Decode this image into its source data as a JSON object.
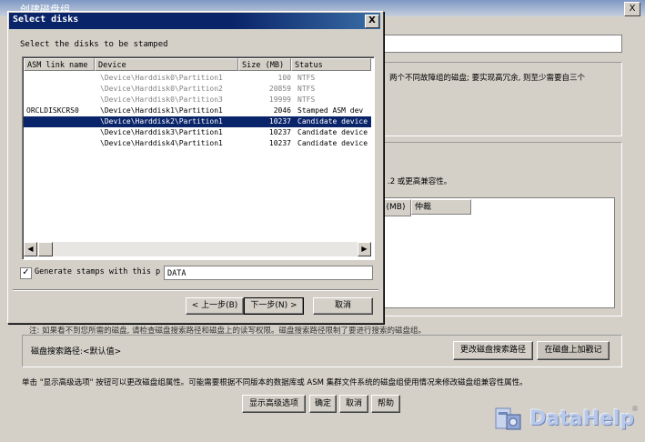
{
  "background_window": {
    "title": "创建磁盘组",
    "close_glyph": "X",
    "redundancy_text": "两个不同故障组的磁盘; 要实现高冗余, 则至少需要自三个",
    "failure_text": ".2 或更高兼容性。",
    "table_headers": [
      "(MB)",
      "仲裁"
    ],
    "note": "注: 如果看不到您所需的磁盘, 请检查磁盘搜索路径和磁盘上的读写权限。磁盘搜索路径限制了要进行搜索的磁盘组。",
    "disk_search_label": "磁盘搜索路径:<默认值>",
    "change_search_button": "更改磁盘搜索路径",
    "stamp_disks_button": "在磁盘上加戳记",
    "info": "单击 \"显示高级选项\" 按钮可以更改磁盘组属性。可能需要根据不同版本的数据库或 ASM 集群文件系统的磁盘组使用情况来修改磁盘组兼容性属性。",
    "advanced_button": "显示高级选项",
    "ok_button": "确定",
    "cancel_button": "取消",
    "help_button": "帮助"
  },
  "dialog": {
    "title": "Select disks",
    "close_glyph": "X",
    "instruction": "Select the disks to be stamped",
    "columns": [
      "ASM link name",
      "Device",
      "Size (MB)",
      "Status"
    ],
    "rows": [
      {
        "asm": "",
        "device": "\\Device\\Harddisk0\\Partition1",
        "size": "100",
        "status": "NTFS",
        "state": "disabled"
      },
      {
        "asm": "",
        "device": "\\Device\\Harddisk0\\Partition2",
        "size": "20859",
        "status": "NTFS",
        "state": "disabled"
      },
      {
        "asm": "",
        "device": "\\Device\\Harddisk0\\Partition3",
        "size": "19999",
        "status": "NTFS",
        "state": "disabled"
      },
      {
        "asm": "ORCLDISKCRS0",
        "device": "\\Device\\Harddisk1\\Partition1",
        "size": "2046",
        "status": "Stamped ASM dev",
        "state": "normal"
      },
      {
        "asm": "",
        "device": "\\Device\\Harddisk2\\Partition1",
        "size": "10237",
        "status": "Candidate device",
        "state": "selected"
      },
      {
        "asm": "",
        "device": "\\Device\\Harddisk3\\Partition1",
        "size": "10237",
        "status": "Candidate device",
        "state": "normal"
      },
      {
        "asm": "",
        "device": "\\Device\\Harddisk4\\Partition1",
        "size": "10237",
        "status": "Candidate device",
        "state": "normal"
      }
    ],
    "generate_checkbox_label": "Generate stamps with this p",
    "generate_checked": true,
    "stamp_prefix_value": "DATA",
    "back_button": "< 上一步(B)",
    "next_button": "下一步(N) >",
    "cancel_button": "取消",
    "scroll_left_glyph": "◀",
    "scroll_right_glyph": "▶",
    "check_glyph": "✓"
  },
  "watermark": {
    "text": "DataHelp",
    "registered": "®"
  },
  "colors": {
    "selection": "#0a246a",
    "dialog_face": "#d4d0c8",
    "title_bar": "#0a246a"
  }
}
